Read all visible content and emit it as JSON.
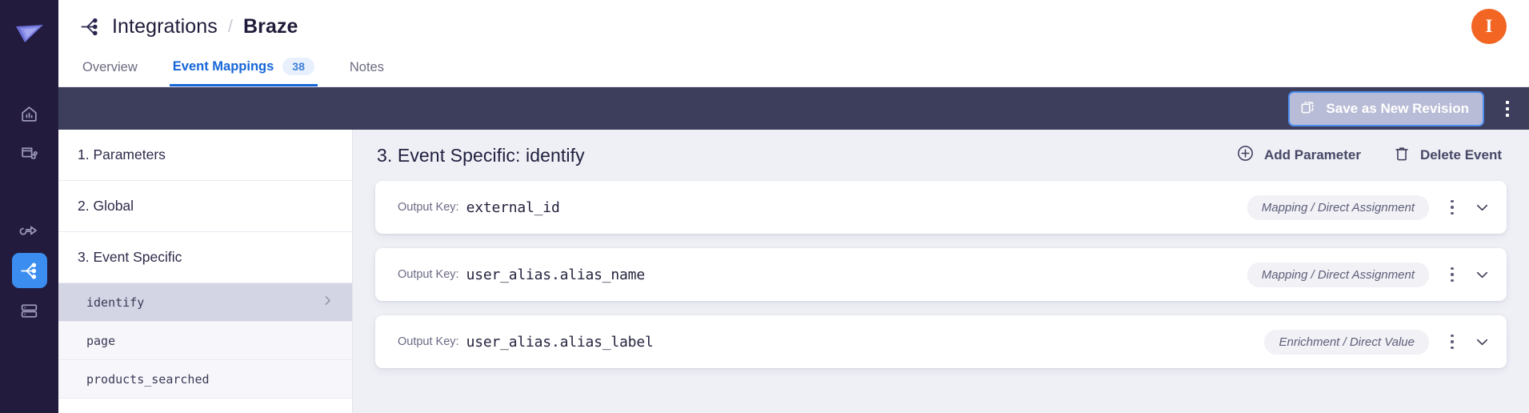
{
  "rail": {
    "logo_icon": "rudderstack-logo-icon",
    "items": [
      {
        "icon": "home-analytics-icon",
        "name": "home",
        "active": false
      },
      {
        "icon": "sources-collect-icon",
        "name": "collect",
        "active": false
      },
      {
        "icon": "transformations-arrow-icon",
        "name": "transformations",
        "active": false
      },
      {
        "icon": "integrations-node-icon",
        "name": "integrations",
        "active": true
      },
      {
        "icon": "database-stack-icon",
        "name": "storage",
        "active": false
      }
    ]
  },
  "header": {
    "breadcrumb_icon": "integrations-node-icon",
    "root": "Integrations",
    "separator": "/",
    "leaf": "Braze",
    "avatar_initial": "I",
    "avatar_color": "#f26522"
  },
  "tabs": [
    {
      "label": "Overview",
      "badge": null,
      "active": false
    },
    {
      "label": "Event Mappings",
      "badge": "38",
      "active": true
    },
    {
      "label": "Notes",
      "badge": null,
      "active": false
    }
  ],
  "toolbar": {
    "save_label": "Save as New Revision",
    "save_icon": "duplicate-icon",
    "menu_icon": "kebab-menu-icon",
    "background": "#3d3d5c"
  },
  "navlist": [
    {
      "type": "section",
      "label": "1. Parameters"
    },
    {
      "type": "section",
      "label": "2. Global"
    },
    {
      "type": "section",
      "label": "3. Event Specific"
    },
    {
      "type": "event",
      "label": "identify",
      "selected": true
    },
    {
      "type": "event",
      "label": "page",
      "selected": false
    },
    {
      "type": "event",
      "label": "products_searched",
      "selected": false
    }
  ],
  "content": {
    "title": "3. Event Specific: identify",
    "add_parameter_label": "Add Parameter",
    "add_parameter_icon": "plus-circle-icon",
    "delete_event_label": "Delete Event",
    "delete_event_icon": "trash-icon",
    "output_key_label": "Output Key:",
    "cards": [
      {
        "output_key": "external_id",
        "badge": "Mapping / Direct Assignment"
      },
      {
        "output_key": "user_alias.alias_name",
        "badge": "Mapping / Direct Assignment"
      },
      {
        "output_key": "user_alias.alias_label",
        "badge": "Enrichment / Direct Value"
      }
    ]
  }
}
